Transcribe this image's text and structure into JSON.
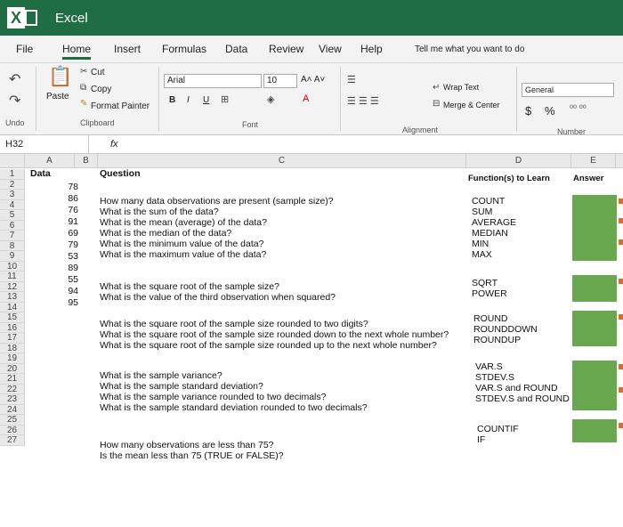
{
  "app": {
    "title": "Excel"
  },
  "tabs": [
    "File",
    "Home",
    "Insert",
    "Formulas",
    "Data",
    "Review",
    "View",
    "Help"
  ],
  "tell_me": {
    "placeholder": "Tell me what you want to do"
  },
  "ribbon": {
    "undo_label": "Undo",
    "paste_label": "Paste",
    "cut_label": "Cut",
    "copy_label": "Copy",
    "format_painter_label": "Format Painter",
    "clipboard_label": "Clipboard",
    "font_name": "Arial",
    "font_size": "10",
    "font_label": "Font",
    "bold": "B",
    "italic": "I",
    "underline": "U",
    "wrap_text_label": "Wrap Text",
    "merge_center_label": "Merge & Center",
    "alignment_label": "Alignment",
    "number_format": "General",
    "number_label": "Number",
    "currency_symbol": "$",
    "percent_symbol": "%"
  },
  "formula_bar": {
    "name_box": "H32",
    "fx": "fx"
  },
  "sheet": {
    "columns": [
      "A",
      "B",
      "C",
      "D",
      "E",
      "Fo"
    ],
    "row_numbers": [
      "1",
      "2",
      "3",
      "4",
      "5",
      "6",
      "7",
      "8",
      "9",
      "10",
      "11",
      "12",
      "13",
      "14",
      "15",
      "16",
      "17",
      "18",
      "19",
      "20",
      "21",
      "22",
      "23",
      "24",
      "25",
      "26",
      "27"
    ],
    "headers": {
      "data": "Data",
      "question": "Question",
      "function": "Function(s) to Learn",
      "answer": "Answer"
    },
    "data_values": [
      "78",
      "86",
      "76",
      "91",
      "69",
      "79",
      "53",
      "89",
      "55",
      "94",
      "95"
    ],
    "questions": [
      "How many data observations are present (sample size)?",
      "What is the sum of the data?",
      "What is the mean (average) of the data?",
      "What is the median of the data?",
      "What is the minimum value of the data?",
      "What is the maximum value of the data?",
      "What is the square root of the sample size?",
      "What is the value of the third observation when squared?",
      "What is the square root of the sample size rounded to two digits?",
      "What is the square root of the sample size rounded down to the next whole number?",
      "What is the square root of the sample size rounded up to the next whole number?",
      "What is the sample variance?",
      "What is the sample standard deviation?",
      "What is the sample variance rounded to two decimals?",
      "What is the sample standard deviation rounded to two decimals?",
      "How many observations are less than 75?",
      "Is the mean less than 75 (TRUE or FALSE)?"
    ],
    "functions": [
      "COUNT",
      "SUM",
      "AVERAGE",
      "MEDIAN",
      "MIN",
      "MAX",
      "SQRT",
      "POWER",
      "ROUND",
      "ROUNDDOWN",
      "ROUNDUP",
      "VAR.S",
      "STDEV.S",
      "VAR.S and ROUND",
      "STDEV.S and ROUND",
      "COUNTIF",
      "IF"
    ]
  }
}
